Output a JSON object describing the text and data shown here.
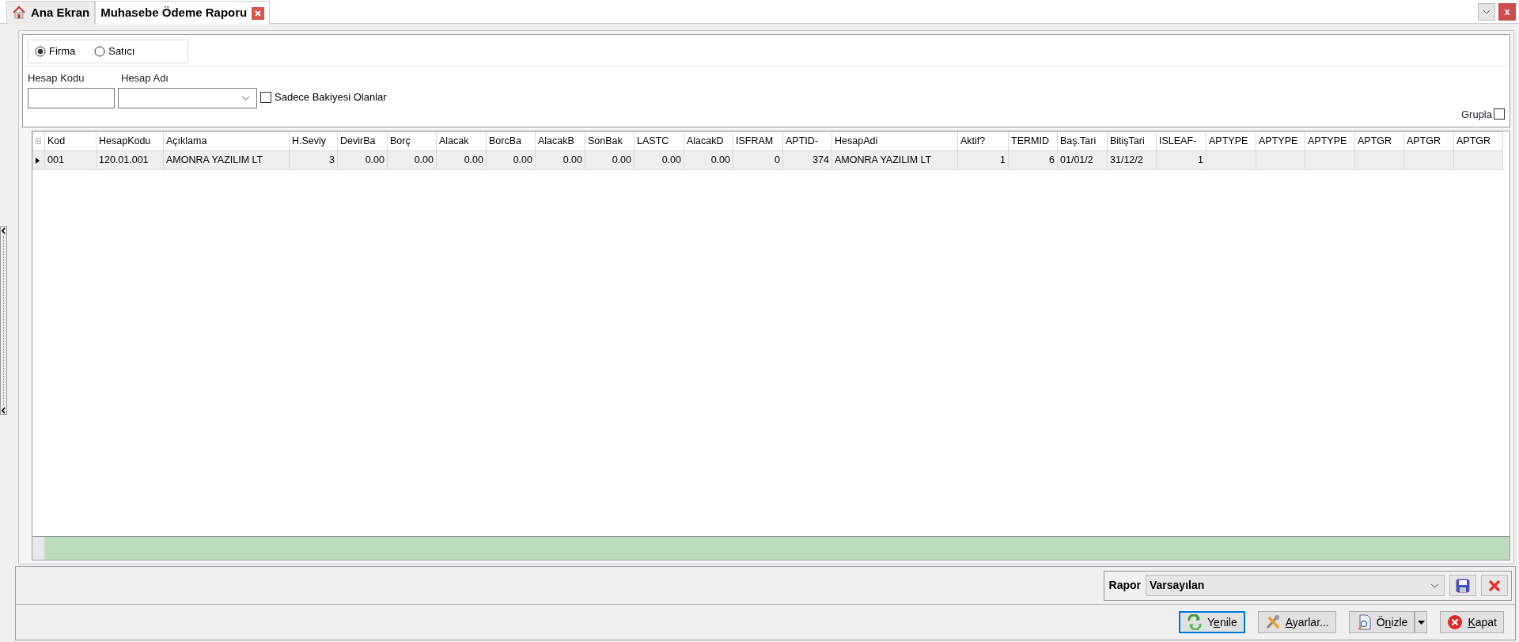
{
  "tabs": [
    {
      "label": "Ana Ekran",
      "selected": false,
      "kind": "home"
    },
    {
      "label": "Muhasebe Ödeme Raporu",
      "selected": true,
      "kind": "closable"
    }
  ],
  "window_close": "x",
  "filter": {
    "radios": [
      {
        "label": "Firma",
        "selected": true
      },
      {
        "label": "Satıcı",
        "selected": false
      }
    ],
    "account_code": {
      "label": "Hesap Kodu"
    },
    "account_name": {
      "label": "Hesap Adı"
    },
    "only_with_balance": {
      "label": "Sadece Bakiyesi Olanlar",
      "checked": false
    },
    "group": {
      "label": "Grupla",
      "checked": false
    }
  },
  "grid": {
    "columns": [
      {
        "label": "Kod",
        "kind": "text"
      },
      {
        "label": "HesapKodu",
        "kind": "text"
      },
      {
        "label": "Açıklama",
        "kind": "text"
      },
      {
        "label": "H.Seviy",
        "kind": "number"
      },
      {
        "label": "DevirBa",
        "kind": "number"
      },
      {
        "label": "Borç",
        "kind": "number"
      },
      {
        "label": "Alacak",
        "kind": "number"
      },
      {
        "label": "BorcBa",
        "kind": "number"
      },
      {
        "label": "AlacakB",
        "kind": "number"
      },
      {
        "label": "SonBak",
        "kind": "number"
      },
      {
        "label": "LASTC",
        "kind": "number"
      },
      {
        "label": "AlacakD",
        "kind": "number"
      },
      {
        "label": "ISFRAM",
        "kind": "number"
      },
      {
        "label": "APTID-",
        "kind": "number"
      },
      {
        "label": "HesapAdi",
        "kind": "text"
      },
      {
        "label": "Aktif?",
        "kind": "number"
      },
      {
        "label": "TERMID",
        "kind": "number"
      },
      {
        "label": "Baş.Tari",
        "kind": "text"
      },
      {
        "label": "BitişTari",
        "kind": "text"
      },
      {
        "label": "ISLEAF-",
        "kind": "number"
      },
      {
        "label": "APTYPE",
        "kind": "text"
      },
      {
        "label": "APTYPE",
        "kind": "text"
      },
      {
        "label": "APTYPE",
        "kind": "text"
      },
      {
        "label": "APTGR",
        "kind": "text"
      },
      {
        "label": "APTGR",
        "kind": "text"
      },
      {
        "label": "APTGR",
        "kind": "text"
      }
    ],
    "rows": [
      {
        "selected": true,
        "cells": [
          "001",
          "120.01.001",
          "AMONRA YAZILIM LT",
          "3",
          "0.00",
          "0.00",
          "0.00",
          "0.00",
          "0.00",
          "0.00",
          "0.00",
          "0.00",
          "0",
          "374",
          "AMONRA YAZILIM LT",
          "1",
          "6",
          "01/01/2",
          "31/12/2",
          "1"
        ]
      }
    ]
  },
  "report": {
    "label": "Rapor",
    "value": "Varsayılan"
  },
  "buttons": [
    {
      "kind": "refresh",
      "before": "Y",
      "key": "e",
      "after": "nile",
      "focused": true
    },
    {
      "kind": "settings",
      "key": "A",
      "after": "yarlar...",
      "focused": false
    },
    {
      "kind": "preview",
      "before": "Ö",
      "key": "n",
      "after": "izle",
      "focused": false
    },
    {
      "kind": "close",
      "key": "K",
      "after": "apat",
      "focused": false
    }
  ]
}
